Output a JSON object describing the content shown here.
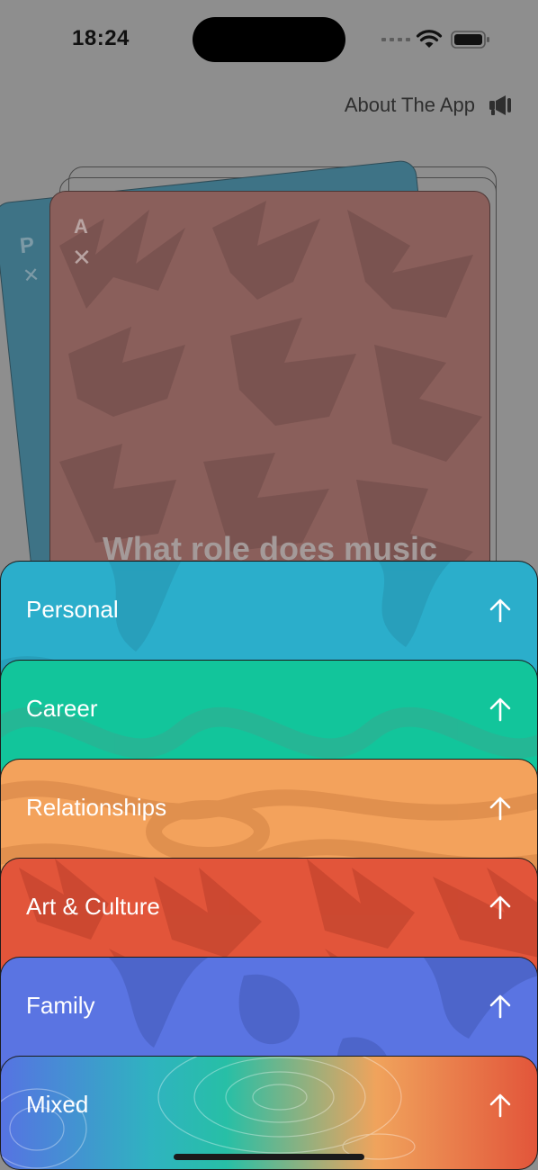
{
  "status_bar": {
    "time": "18:24"
  },
  "header": {
    "about_label": "About The App"
  },
  "deck": {
    "back_card": {
      "letter": "P",
      "mark": "✕",
      "color": "#3e7386"
    },
    "front_card": {
      "letter": "A",
      "mark": "✕",
      "color": "#8a5f5b",
      "question": "What role does music"
    }
  },
  "categories": [
    {
      "label": "Personal",
      "color": "#2baecb"
    },
    {
      "label": "Career",
      "color": "#12c59b"
    },
    {
      "label": "Relationships",
      "color": "#f3a25c"
    },
    {
      "label": "Art & Culture",
      "color": "#e2553a"
    },
    {
      "label": "Family",
      "color": "#5a74e2"
    },
    {
      "label": "Mixed",
      "colors": [
        "#5673e2",
        "#27bfa6",
        "#f0a35c",
        "#e2553a"
      ]
    }
  ],
  "icons": {
    "about": "megaphone-icon",
    "category_action": "arrow-up-icon",
    "card_mark": "close-icon"
  }
}
